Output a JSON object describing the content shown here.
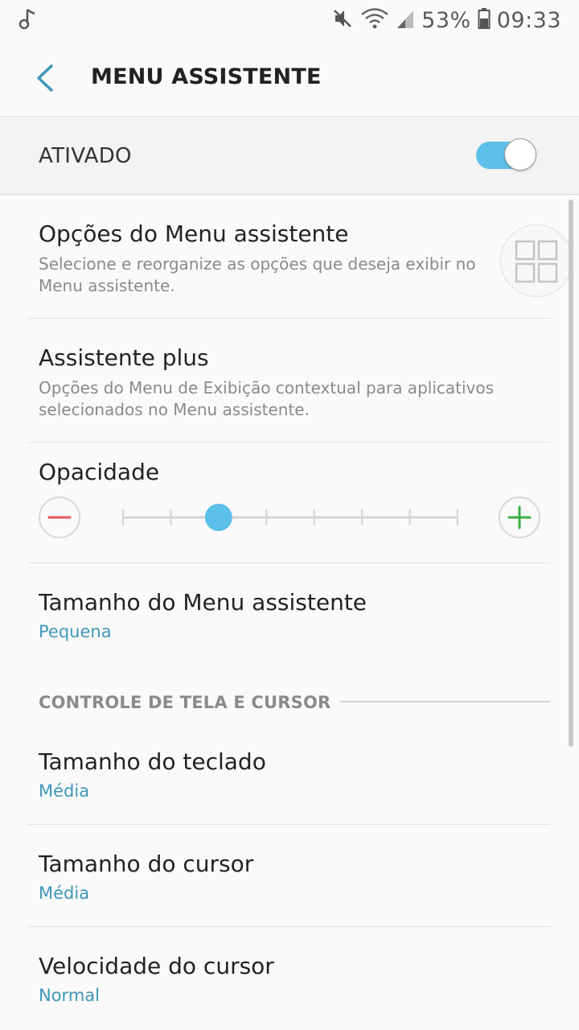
{
  "status_bar": {
    "battery": "53%",
    "time": "09:33",
    "icons": [
      "music-note-icon",
      "mute-icon",
      "wifi-icon",
      "signal-icon",
      "battery-icon"
    ]
  },
  "header": {
    "title": "MENU ASSISTENTE",
    "back_icon": "back-arrow-icon"
  },
  "master_switch": {
    "label": "ATIVADO",
    "on": true
  },
  "settings": {
    "options": {
      "title": "Opções do Menu assistente",
      "description": "Selecione e reorganize as opções que deseja exibir no Menu assistente."
    },
    "plus": {
      "title": "Assistente plus",
      "description": "Opções do Menu de Exibição contextual para aplicativos selecionados no Menu assistente."
    },
    "opacity": {
      "title": "Opacidade",
      "level": 2,
      "steps": 8
    },
    "menu_size": {
      "title": "Tamanho do Menu assistente",
      "value": "Pequena"
    }
  },
  "section": {
    "label": "CONTROLE DE TELA E CURSOR"
  },
  "cursor_settings": {
    "keyboard_size": {
      "title": "Tamanho do teclado",
      "value": "Média"
    },
    "cursor_size": {
      "title": "Tamanho do cursor",
      "value": "Média"
    },
    "cursor_speed": {
      "title": "Velocidade do cursor",
      "value": "Normal"
    }
  },
  "colors": {
    "accent": "#5dc0e8",
    "value_text": "#3e97b7",
    "minus": "#e0575b",
    "plus": "#3cb043"
  }
}
